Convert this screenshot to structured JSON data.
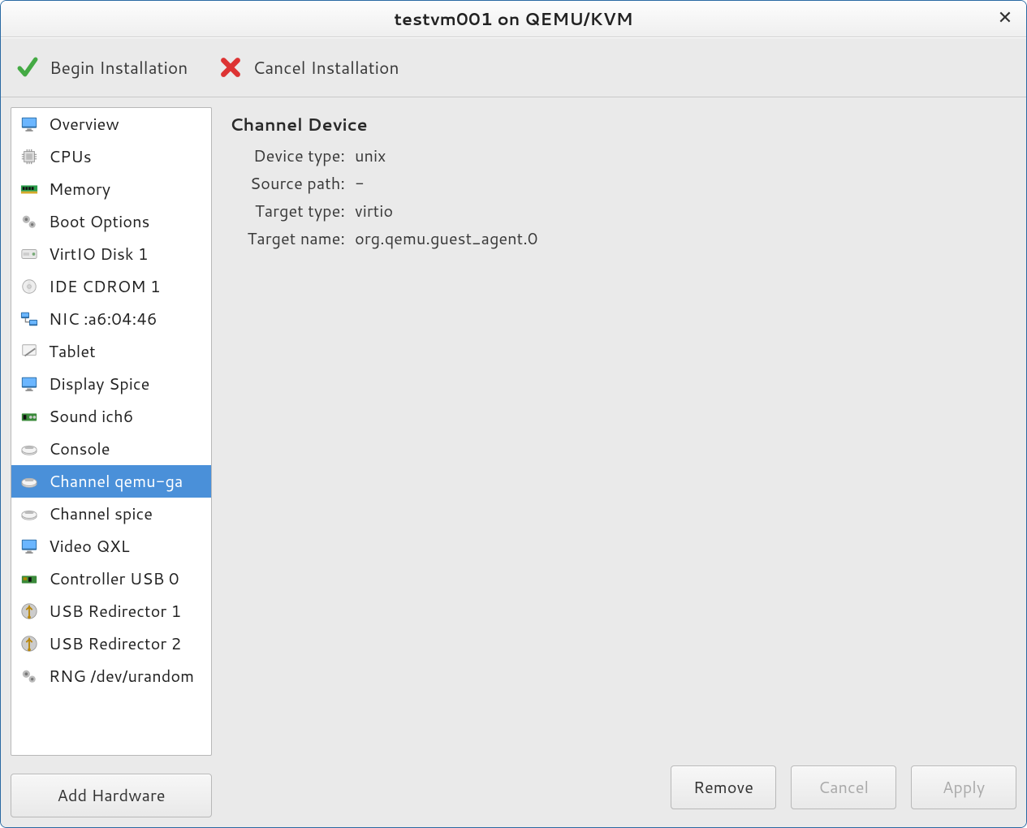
{
  "window": {
    "title": "testvm001 on QEMU/KVM"
  },
  "toolbar": {
    "begin_label": "Begin Installation",
    "cancel_label": "Cancel Installation"
  },
  "sidebar": {
    "items": [
      {
        "label": "Overview",
        "icon": "monitor",
        "selected": false
      },
      {
        "label": "CPUs",
        "icon": "cpu",
        "selected": false
      },
      {
        "label": "Memory",
        "icon": "memory",
        "selected": false
      },
      {
        "label": "Boot Options",
        "icon": "gears",
        "selected": false
      },
      {
        "label": "VirtIO Disk 1",
        "icon": "disk",
        "selected": false
      },
      {
        "label": "IDE CDROM 1",
        "icon": "cdrom",
        "selected": false
      },
      {
        "label": "NIC :a6:04:46",
        "icon": "nic",
        "selected": false
      },
      {
        "label": "Tablet",
        "icon": "tablet",
        "selected": false
      },
      {
        "label": "Display Spice",
        "icon": "monitor",
        "selected": false
      },
      {
        "label": "Sound ich6",
        "icon": "sound",
        "selected": false
      },
      {
        "label": "Console",
        "icon": "serial",
        "selected": false
      },
      {
        "label": "Channel qemu-ga",
        "icon": "serial",
        "selected": true
      },
      {
        "label": "Channel spice",
        "icon": "serial",
        "selected": false
      },
      {
        "label": "Video QXL",
        "icon": "monitor",
        "selected": false
      },
      {
        "label": "Controller USB 0",
        "icon": "usbctrl",
        "selected": false
      },
      {
        "label": "USB Redirector 1",
        "icon": "usb",
        "selected": false
      },
      {
        "label": "USB Redirector 2",
        "icon": "usb",
        "selected": false
      },
      {
        "label": "RNG /dev/urandom",
        "icon": "gears",
        "selected": false
      }
    ],
    "add_hardware_label": "Add Hardware"
  },
  "details": {
    "title": "Channel Device",
    "props": [
      {
        "label": "Device type:",
        "value": "unix"
      },
      {
        "label": "Source path:",
        "value": "-"
      },
      {
        "label": "Target type:",
        "value": "virtio"
      },
      {
        "label": "Target name:",
        "value": "org.qemu.guest_agent.0"
      }
    ]
  },
  "footer": {
    "remove_label": "Remove",
    "cancel_label": "Cancel",
    "apply_label": "Apply"
  }
}
